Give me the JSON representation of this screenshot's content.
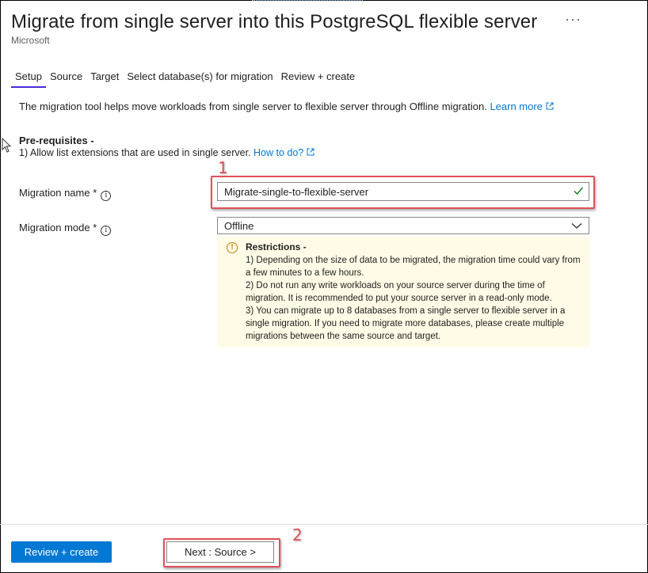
{
  "header": {
    "title": "Migrate from single server into this PostgreSQL flexible server",
    "more_label": "···",
    "publisher": "Microsoft"
  },
  "tabs": [
    {
      "label": "Setup",
      "active": true
    },
    {
      "label": "Source",
      "active": false
    },
    {
      "label": "Target",
      "active": false
    },
    {
      "label": "Select database(s) for migration",
      "active": false
    },
    {
      "label": "Review + create",
      "active": false
    }
  ],
  "intro": {
    "text": "The migration tool helps move workloads from single server to flexible server through Offline migration.",
    "link": "Learn more"
  },
  "prereq": {
    "title": "Pre-requisites -",
    "item": "1) Allow list extensions that are used in single server.",
    "link": "How to do?"
  },
  "form": {
    "migration_name_label": "Migration name *",
    "migration_name_value": "Migrate-single-to-flexible-server",
    "migration_mode_label": "Migration mode *",
    "migration_mode_value": "Offline"
  },
  "restrictions": {
    "title": "Restrictions -",
    "lines": [
      "1) Depending on the size of data to be migrated, the migration time could vary from a few minutes to a few hours.",
      "2) Do not run any write workloads on your source server during the time of migration. It is recommended to put your source server in a read-only mode.",
      "3) You can migrate up to 8 databases from a single server to flexible server in a single migration. If you need to migrate more databases, please create multiple migrations between the same source and target."
    ]
  },
  "annotations": {
    "one": "1",
    "two": "2"
  },
  "footer": {
    "review_create": "Review + create",
    "next_source": "Next : Source >"
  },
  "colors": {
    "accent": "#0078d4",
    "tab_underline": "#4b2bd6",
    "annotation": "#e2505a",
    "warning_bg": "#fffbe6",
    "warning_icon": "#c87c0a",
    "success": "#107c10"
  }
}
